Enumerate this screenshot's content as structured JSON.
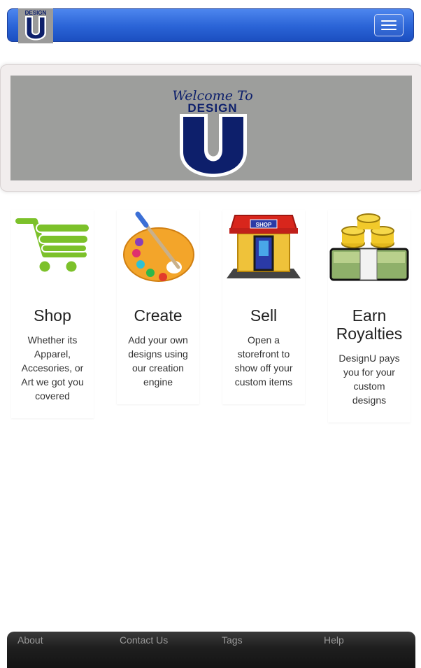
{
  "navbar": {
    "brand_text": "DESIGN",
    "brand_letter": "U",
    "toggle_label": "Toggle navigation"
  },
  "hero": {
    "welcome_text": "Welcome To",
    "brand_text": "DESIGN",
    "brand_letter": "U"
  },
  "features": [
    {
      "title": "Shop",
      "title2": "",
      "description": [
        "Whether its",
        "Apparel,",
        "Accesories, or",
        "Art we got you",
        "covered"
      ],
      "icon": "shopping-cart-icon"
    },
    {
      "title": "Create",
      "title2": "",
      "description": [
        "Add your own",
        "designs using",
        "our creation",
        "engine"
      ],
      "icon": "paint-palette-icon"
    },
    {
      "title": "Sell",
      "title2": "",
      "description": [
        "Open a",
        "storefront to",
        "show off your",
        "custom items"
      ],
      "icon": "storefront-icon"
    },
    {
      "title": "Earn",
      "title2": "Royalties",
      "description": [
        "DesignU pays",
        "you for your",
        "custom",
        "designs"
      ],
      "icon": "money-stack-icon"
    }
  ],
  "footer": {
    "links": [
      "About",
      "Contact Us",
      "Tags",
      "Help"
    ]
  },
  "colors": {
    "navbar_blue": "#2a63d6",
    "brand_navy": "#0d1f6b",
    "hero_gray": "#9d9e9c",
    "footer_dark": "#1e1e1e"
  }
}
